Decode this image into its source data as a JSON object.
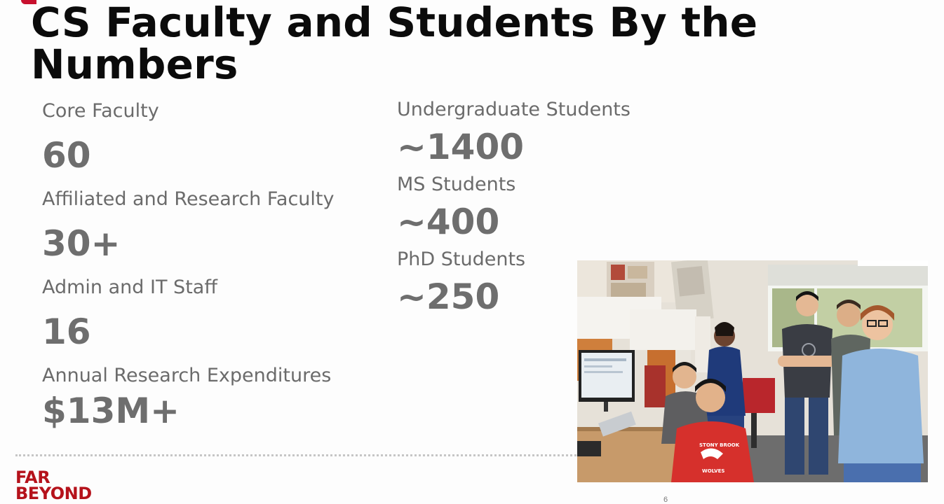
{
  "slide": {
    "title": "CS Faculty and Students By the Numbers",
    "page_number": "6"
  },
  "stats_left": [
    {
      "label": "Core Faculty",
      "value": "60"
    },
    {
      "label": "Affiliated and Research Faculty",
      "value": "30+"
    },
    {
      "label": "Admin and IT Staff",
      "value": "16"
    },
    {
      "label": "Annual Research Expenditures",
      "value": "$13M+"
    }
  ],
  "stats_right": [
    {
      "label": "Undergraduate Students",
      "value": "~1400"
    },
    {
      "label": "MS Students",
      "value": "~400"
    },
    {
      "label": "PhD Students",
      "value": "~250"
    }
  ],
  "logo": {
    "line1": "FAR",
    "line2": "BEYOND"
  },
  "photo": {
    "shirt_text_1": "STONY BROOK",
    "shirt_text_2": "WOLVES"
  },
  "colors": {
    "brand_red": "#b5121b",
    "label_gray": "#6b6b6b",
    "title_black": "#0b0b0b"
  }
}
